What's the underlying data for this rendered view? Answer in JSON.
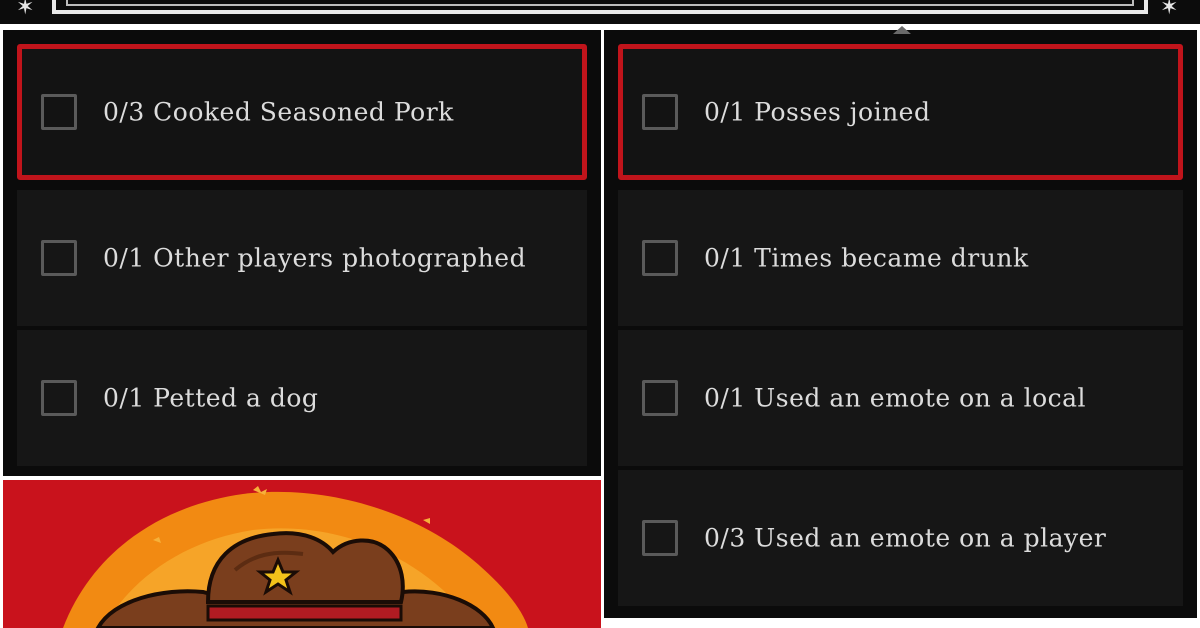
{
  "colors": {
    "panel_background": "#0b0b0b",
    "row_background": "#161616",
    "selected_outline": "#c0141b",
    "text": "#dcdcdc",
    "art_red": "#c9121c",
    "art_orange": "#f28a12",
    "hat_brown": "#7a3e1d",
    "badge_yellow": "#f2c21a"
  },
  "icons": {
    "banner_left": "star-ornament-icon",
    "banner_right": "star-ornament-icon",
    "badge": "star-icon"
  },
  "left_list": {
    "items": [
      {
        "label": "0/3 Cooked Seasoned Pork",
        "progress": 0,
        "goal": 3,
        "selected": true
      },
      {
        "label": "0/1 Other players photographed",
        "progress": 0,
        "goal": 1,
        "selected": false
      },
      {
        "label": "0/1 Petted a dog",
        "progress": 0,
        "goal": 1,
        "selected": false
      }
    ]
  },
  "right_list": {
    "items": [
      {
        "label": "0/1 Posses joined",
        "progress": 0,
        "goal": 1,
        "selected": true
      },
      {
        "label": "0/1 Times became drunk",
        "progress": 0,
        "goal": 1,
        "selected": false
      },
      {
        "label": "0/1 Used an emote on a local",
        "progress": 0,
        "goal": 1,
        "selected": false
      },
      {
        "label": "0/3 Used an emote on a player",
        "progress": 0,
        "goal": 3,
        "selected": false
      }
    ]
  }
}
